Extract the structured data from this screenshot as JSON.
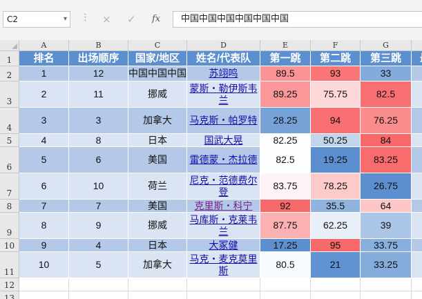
{
  "formula_bar": {
    "name_box": "C2",
    "cancel_icon": "×",
    "enter_icon": "✓",
    "fx_label": "fx",
    "formula_text": "中国中国中国中国中国中国"
  },
  "columns": [
    "A",
    "B",
    "C",
    "D",
    "E",
    "F",
    "G",
    "H"
  ],
  "rows": [
    "1",
    "2",
    "3",
    "4",
    "5",
    "6",
    "7",
    "8",
    "9",
    "10",
    "11",
    "12",
    "13"
  ],
  "headers": [
    "排名",
    "出场顺序",
    "国家/地区",
    "姓名/代表队",
    "第一跳",
    "第二跳",
    "第三跳",
    "最"
  ],
  "data_rows": [
    {
      "rank": "1",
      "order": "12",
      "country": "中国中国中国中",
      "name": "苏翊鸣",
      "j1": "89.5",
      "j2": "93",
      "j3": "33"
    },
    {
      "rank": "2",
      "order": "11",
      "country": "挪威",
      "name": "蒙斯・勒伊斯韦兰",
      "j1": "89.25",
      "j2": "75.75",
      "j3": "82.5"
    },
    {
      "rank": "3",
      "order": "3",
      "country": "加拿大",
      "name": "马克斯・帕罗特",
      "j1": "28.25",
      "j2": "94",
      "j3": "76.25"
    },
    {
      "rank": "4",
      "order": "8",
      "country": "日本",
      "name": "国武大晃",
      "j1": "82.25",
      "j2": "50.25",
      "j3": "84"
    },
    {
      "rank": "5",
      "order": "6",
      "country": "美国",
      "name": "雷德蒙・杰拉德",
      "j1": "82.5",
      "j2": "19.25",
      "j3": "83.25"
    },
    {
      "rank": "6",
      "order": "10",
      "country": "荷兰",
      "name": "尼克・范德费尔登",
      "j1": "83.75",
      "j2": "78.25",
      "j3": "26.75"
    },
    {
      "rank": "7",
      "order": "7",
      "country": "美国",
      "name": "克里斯・科宁",
      "j1": "92",
      "j2": "35.5",
      "j3": "64"
    },
    {
      "rank": "8",
      "order": "9",
      "country": "挪威",
      "name": "马库斯・克莱韦兰",
      "j1": "87.75",
      "j2": "62.25",
      "j3": "39"
    },
    {
      "rank": "9",
      "order": "4",
      "country": "日本",
      "name": "大冢健",
      "j1": "17.25",
      "j2": "95",
      "j3": "33.75"
    },
    {
      "rank": "10",
      "order": "5",
      "country": "加拿大",
      "name": "马克・麦克莫里斯",
      "j1": "80.5",
      "j2": "21",
      "j3": "33.25"
    }
  ],
  "colors": {
    "header_bg": "#5b8fd0",
    "band_dark": "#b4c9e7",
    "band_light": "#dae4f2",
    "scale_low": "#5b8fd0",
    "scale_mid": "#ffffff",
    "scale_high": "#f8696b"
  }
}
